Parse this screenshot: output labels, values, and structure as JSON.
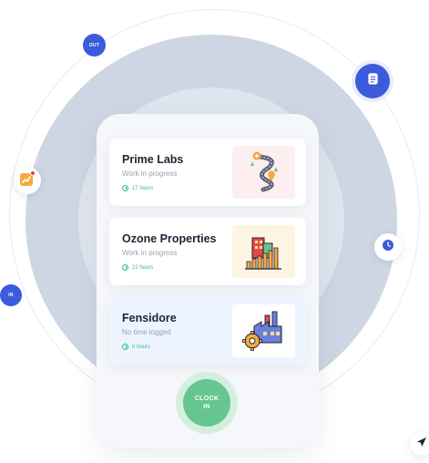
{
  "projects": [
    {
      "name": "Prime Labs",
      "status": "Work in progress",
      "time": "17 hours",
      "icon": "roadmap-icon",
      "thumb_bg": "#fdeff0"
    },
    {
      "name": "Ozone Properties",
      "status": "Work in progress",
      "time": "22 hours",
      "icon": "buildings-chart-icon",
      "thumb_bg": "#fdf5e3"
    },
    {
      "name": "Fensidore",
      "status": "No time logged",
      "time": "0 hours",
      "icon": "factory-gear-icon",
      "thumb_bg": "#ffffff"
    }
  ],
  "clock_button": {
    "line1": "CLOCK",
    "line2": "IN"
  },
  "badges": {
    "out": "OUT",
    "in": "IN"
  },
  "colors": {
    "accent_blue": "#3b5bdb",
    "accent_green": "#66c690",
    "time_green": "#2fb98a",
    "chart_orange": "#f4a940"
  }
}
